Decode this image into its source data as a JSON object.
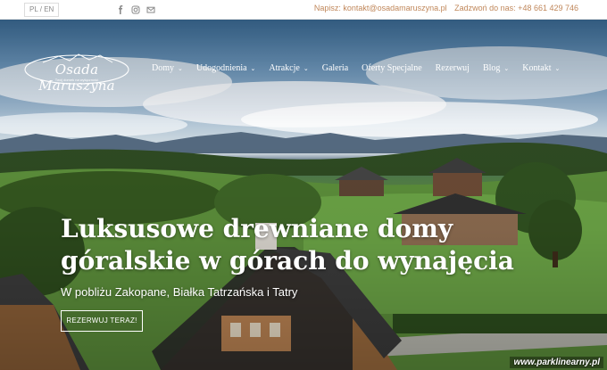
{
  "topbar": {
    "lang_pl": "PL",
    "lang_sep": "/",
    "lang_en": "EN",
    "social_icons": [
      "facebook-icon",
      "instagram-icon",
      "email-icon"
    ],
    "contact_email": "Napisz: kontakt@osadamaruszyna.pl",
    "contact_phone": "Zadzwoń do nas: +48 661 429 746",
    "accent_color": "#c0875a"
  },
  "logo": {
    "name": "Osada Maruszyna",
    "tagline": "Twój domek na wyłączność"
  },
  "nav": {
    "items": [
      {
        "label": "Domy",
        "chevron": "⌄"
      },
      {
        "label": "Udogodnienia",
        "chevron": "⌄"
      },
      {
        "label": "Atrakcje",
        "chevron": "⌄"
      },
      {
        "label": "Galeria"
      },
      {
        "label": "Oferty Specjalne"
      },
      {
        "label": "Rezerwuj"
      },
      {
        "label": "Blog",
        "chevron": "⌄"
      },
      {
        "label": "Kontakt",
        "chevron": "⌄"
      }
    ]
  },
  "hero": {
    "headline_line1": "Luksusowe drewniane domy",
    "headline_line2": "góralskie w górach do wynajęcia",
    "subline": "W pobliżu Zakopane, Białka Tatrzańska i Tatry",
    "cta": "REZERWUJ TERAZ!"
  },
  "watermark": "www.parklinearny.pl"
}
